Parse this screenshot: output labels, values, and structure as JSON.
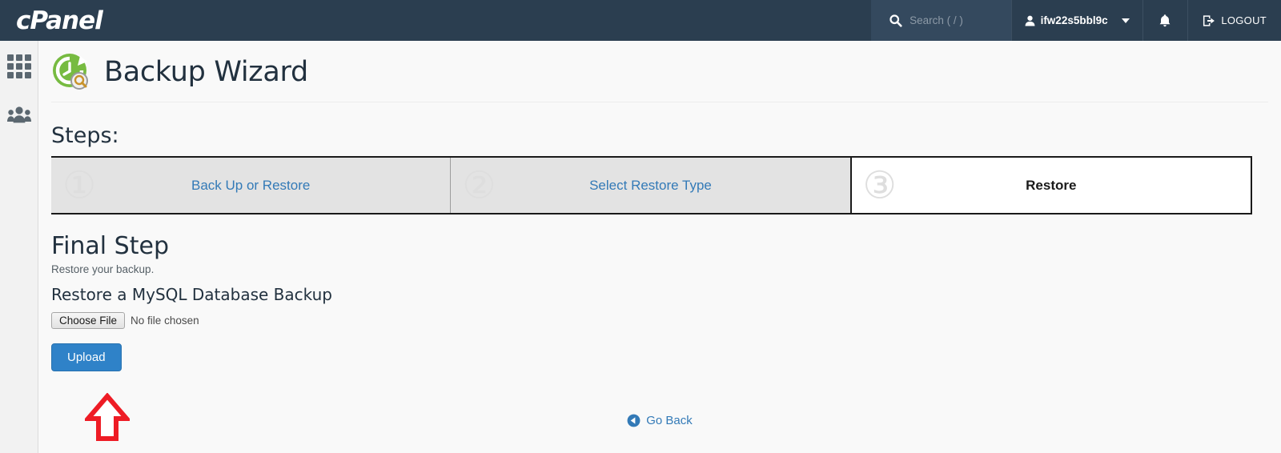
{
  "header": {
    "brand": "cPanel",
    "search": {
      "icon": "search-icon",
      "placeholder": "Search ( / )",
      "value": ""
    },
    "user": {
      "icon": "user-icon",
      "name": "ifw22s5bbl9c",
      "caret": "chevron-down-icon"
    },
    "notifications_icon": "bell-icon",
    "logout": {
      "icon": "logout-icon",
      "label": "LOGOUT"
    }
  },
  "sidebar": {
    "items": [
      {
        "name": "apps-grid-icon",
        "label": ""
      },
      {
        "name": "users-icon",
        "label": ""
      }
    ]
  },
  "page": {
    "icon": "backup-wizard-icon",
    "title": "Backup Wizard",
    "steps_label": "Steps:"
  },
  "steps": [
    {
      "number": "①",
      "label": "Back Up or Restore",
      "active": false
    },
    {
      "number": "②",
      "label": "Select Restore Type",
      "active": false
    },
    {
      "number": "③",
      "label": "Restore",
      "active": true
    }
  ],
  "main": {
    "final_step_title": "Final Step",
    "sub_text": "Restore your backup.",
    "restore_heading": "Restore a MySQL Database Backup",
    "file_input": {
      "button_label": "Choose File",
      "file_name": "No file chosen"
    },
    "upload_label": "Upload",
    "go_back": {
      "icon": "arrow-circle-left-icon",
      "label": "Go Back"
    }
  },
  "annotation": {
    "arrow": "red-up-arrow",
    "color": "#ee1c25"
  },
  "colors": {
    "header_bg": "#2b3e50",
    "search_bg": "#34495e",
    "link": "#337ab7",
    "upload_button": "#2f82c8",
    "step_inactive_bg": "#e3e3e3",
    "step_active_bg": "#ffffff",
    "page_bg": "#f9f9f9",
    "sidebar_bg": "#f2f2f2",
    "icon_green": "#77bb41"
  }
}
